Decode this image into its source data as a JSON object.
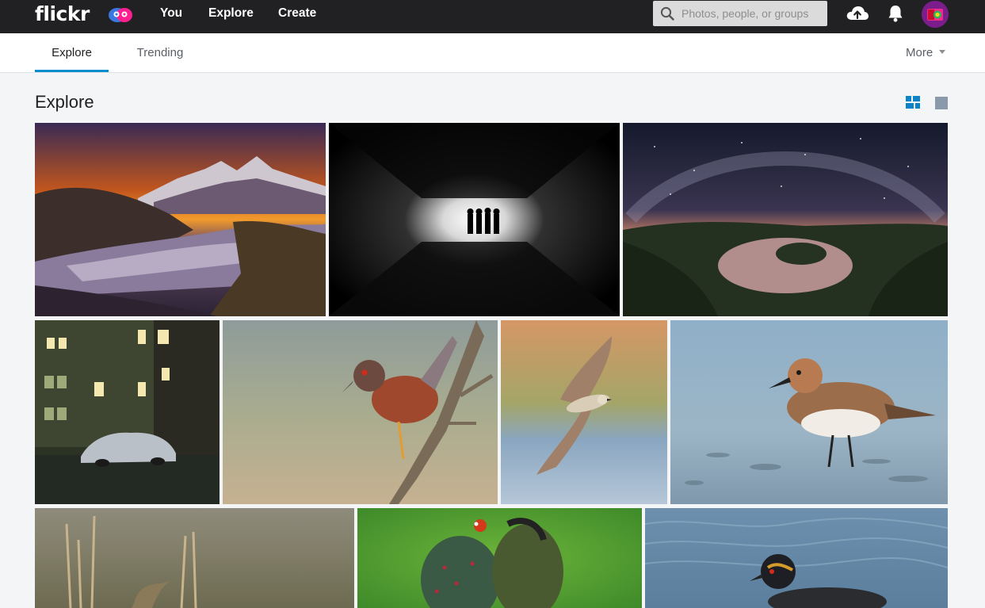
{
  "header": {
    "logo_text": "flickr",
    "nav": [
      {
        "label": "You"
      },
      {
        "label": "Explore"
      },
      {
        "label": "Create"
      }
    ],
    "search": {
      "placeholder": "Photos, people, or groups"
    },
    "icons": [
      "upload-cloud-icon",
      "notifications-bell-icon",
      "avatar"
    ]
  },
  "subnav": {
    "tabs": [
      {
        "label": "Explore",
        "active": true
      },
      {
        "label": "Trending",
        "active": false
      }
    ],
    "more_label": "More"
  },
  "main": {
    "title": "Explore",
    "view_modes": [
      "justified-grid-icon",
      "single-photo-icon"
    ],
    "photos": [
      {
        "subject": "mountain-river-sunset"
      },
      {
        "subject": "tunnel-silhouettes"
      },
      {
        "subject": "milky-way-river-bend"
      },
      {
        "subject": "night-street-covered-car"
      },
      {
        "subject": "bird-on-branch"
      },
      {
        "subject": "bird-in-flight"
      },
      {
        "subject": "sandpiper-on-beach"
      },
      {
        "subject": "bird-in-reeds"
      },
      {
        "subject": "beetle-macro"
      },
      {
        "subject": "grebe-on-water"
      }
    ]
  },
  "colors": {
    "topbar": "#212124",
    "accent": "#008ecf",
    "background": "#f3f5f6"
  }
}
